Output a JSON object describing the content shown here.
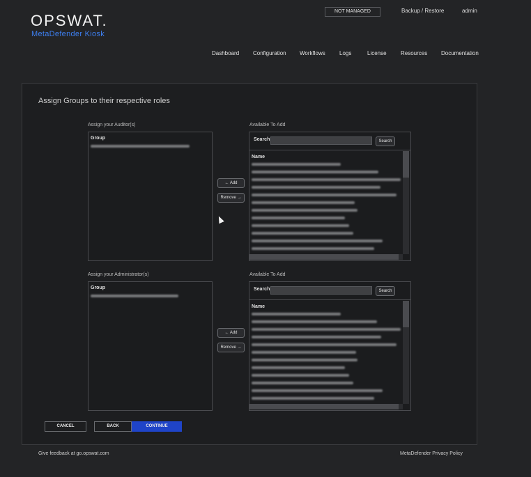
{
  "header": {
    "logo": "OPSWAT.",
    "product": "MetaDefender Kiosk",
    "status_badge": "NOT MANAGED",
    "backup_link": "Backup / Restore",
    "user": "admin"
  },
  "nav": {
    "items": [
      "Dashboard",
      "Configuration",
      "Workflows",
      "Logs",
      "License",
      "Resources",
      "Documentation"
    ]
  },
  "main": {
    "title": "Assign Groups to their respective roles",
    "auditors": {
      "label": "Assign your Auditor(s)",
      "column": "Group",
      "available_label": "Available To Add",
      "search_label": "Search",
      "search_button": "Search",
      "list_header": "Name",
      "add_button": "← Add",
      "remove_button": "Remove →"
    },
    "administrators": {
      "label": "Assign your Administrator(s)",
      "column": "Group",
      "available_label": "Available To Add",
      "search_label": "Search",
      "search_button": "Search",
      "list_header": "Name",
      "add_button": "← Add",
      "remove_button": "Remove →"
    },
    "buttons": {
      "cancel": "CANCEL",
      "back": "BACK",
      "continue": "CONTINUE"
    }
  },
  "footer": {
    "feedback": "Give feedback at go.opswat.com",
    "privacy": "MetaDefender Privacy Policy"
  },
  "colors": {
    "background": "#232426",
    "accent": "#3d7ff0",
    "continue_button": "#1f44c8"
  }
}
